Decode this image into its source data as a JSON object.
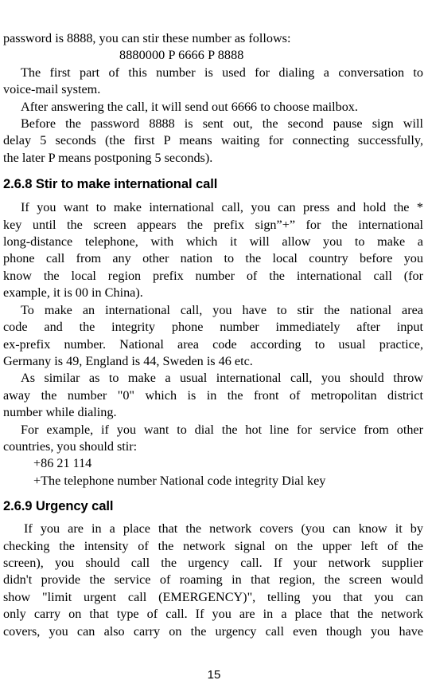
{
  "document": {
    "page_number": "15",
    "body_blocks": [
      {
        "type": "paragraph",
        "id": "voicemail-intro",
        "lines": [
          {
            "text": "password is 8888, you can stir these number as follows:",
            "style": "flush"
          },
          {
            "text": "8880000 P 6666 P 8888",
            "style": "example"
          }
        ]
      },
      {
        "type": "paragraph",
        "id": "first-part-dialing",
        "lines": [
          {
            "text": "The first part of this number is used for dialing a conversation to",
            "style": "indent"
          },
          {
            "text": "voice-mail system.",
            "style": "flush"
          }
        ]
      },
      {
        "type": "paragraph",
        "id": "after-answering",
        "lines": [
          {
            "text": "After answering the call, it will send out 6666 to choose mailbox.",
            "style": "indent flush"
          }
        ]
      },
      {
        "type": "paragraph",
        "id": "pause-sign-explanation",
        "lines": [
          {
            "text": "Before the password 8888 is sent out, the second pause sign will",
            "style": "indent"
          },
          {
            "text": "delay 5 seconds (the first P means waiting for connecting successfully,",
            "style": ""
          },
          {
            "text": "the later P means postponing 5 seconds).",
            "style": "flush"
          }
        ]
      },
      {
        "type": "heading",
        "id": "heading-268",
        "text": "2.6.8 Stir to make international call"
      },
      {
        "type": "paragraph",
        "id": "international-prefix",
        "lines": [
          {
            "text": "If you want to make international call, you can press and hold the *",
            "style": "indent"
          },
          {
            "text": "key until the screen appears the prefix sign”+” for the international",
            "style": ""
          },
          {
            "text": "long-distance telephone, with which it will allow you to make a",
            "style": ""
          },
          {
            "text": "phone call from any other nation to the local country before you",
            "style": ""
          },
          {
            "text": "know the local region prefix number of the international call (for",
            "style": ""
          },
          {
            "text": "example, it is 00 in China).",
            "style": "flush"
          }
        ]
      },
      {
        "type": "paragraph",
        "id": "national-area-code",
        "lines": [
          {
            "text": "To make an international call, you have to stir the national area",
            "style": "indent"
          },
          {
            "text": "code and the integrity phone number immediately after input",
            "style": ""
          },
          {
            "text": "ex-prefix number. National area code according to usual practice,",
            "style": ""
          },
          {
            "text": "Germany is 49, England is 44, Sweden is 46 etc.",
            "style": "flush"
          }
        ]
      },
      {
        "type": "paragraph",
        "id": "drop-leading-zero",
        "lines": [
          {
            "text": "As similar as to make a usual international call, you should throw",
            "style": "indent"
          },
          {
            "text": "away the number \"0\" which is in the front of metropolitan district",
            "style": ""
          },
          {
            "text": "number while dialing.",
            "style": "flush"
          }
        ]
      },
      {
        "type": "paragraph",
        "id": "hotline-example",
        "lines": [
          {
            "text": "For example, if you want to dial the hot line for service from other",
            "style": "indent"
          },
          {
            "text": "countries, you should stir:",
            "style": "flush"
          },
          {
            "text": "+86 21 114",
            "style": "dial"
          },
          {
            "text": "+The telephone number National code integrity Dial key",
            "style": "dial"
          }
        ]
      },
      {
        "type": "heading",
        "id": "heading-269",
        "text": "2.6.9 Urgency call"
      },
      {
        "type": "paragraph",
        "id": "urgency-call-body",
        "lines": [
          {
            "text": "If you are in a place that the network covers (you can know it by",
            "style": "indent-wide"
          },
          {
            "text": "checking the intensity of the network signal on the upper left of the",
            "style": ""
          },
          {
            "text": "screen), you should call the urgency call. If your network supplier",
            "style": ""
          },
          {
            "text": "didn't provide the service of roaming in that region, the screen would",
            "style": ""
          },
          {
            "text": "show \"limit urgent call (EMERGENCY)\", telling you that you can",
            "style": ""
          },
          {
            "text": "only carry on that type of call. If you are in a place that the network",
            "style": ""
          },
          {
            "text": "covers, you can also carry on the urgency call even though you have",
            "style": ""
          }
        ]
      }
    ]
  }
}
